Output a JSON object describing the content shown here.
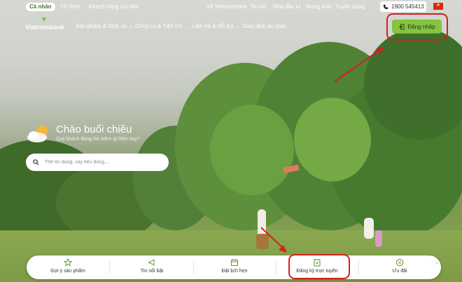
{
  "topbar": {
    "segments": [
      "Cá nhân",
      "Tổ chức",
      "Khách hàng Ưu tiên"
    ],
    "links": [
      "Về Vietcombank",
      "Tin tức",
      "Nhà đầu tư",
      "Mạng lưới",
      "Tuyển dụng"
    ],
    "hotline": "1900 545413"
  },
  "brand": {
    "name": "Vietcombank"
  },
  "nav": {
    "items": [
      "Sản phẩm & Dịch vụ",
      "Công cụ & Tiện ích",
      "Liên hệ & Hỗ trợ",
      "Giao dịch an toàn"
    ],
    "login_label": "Đăng nhập"
  },
  "hero": {
    "greeting": "Chào buổi chiều",
    "subtitle": "Quý khách đang tìm kiếm gì hôm nay?",
    "search_placeholder": "Thẻ tín dụng, vay tiêu dùng,..."
  },
  "quick_bar": {
    "items": [
      "Gợi ý sản phẩm",
      "Tin nổi bật",
      "Đặt lịch hẹn",
      "Đăng ký trực tuyến",
      "Ưu đãi"
    ]
  },
  "colors": {
    "brand_green": "#86c33f",
    "annotation_red": "#d41f1f"
  },
  "icons": [
    "login-icon",
    "phone-icon",
    "search-icon",
    "star-icon",
    "megaphone-icon",
    "calendar-icon",
    "register-icon",
    "discount-icon"
  ]
}
